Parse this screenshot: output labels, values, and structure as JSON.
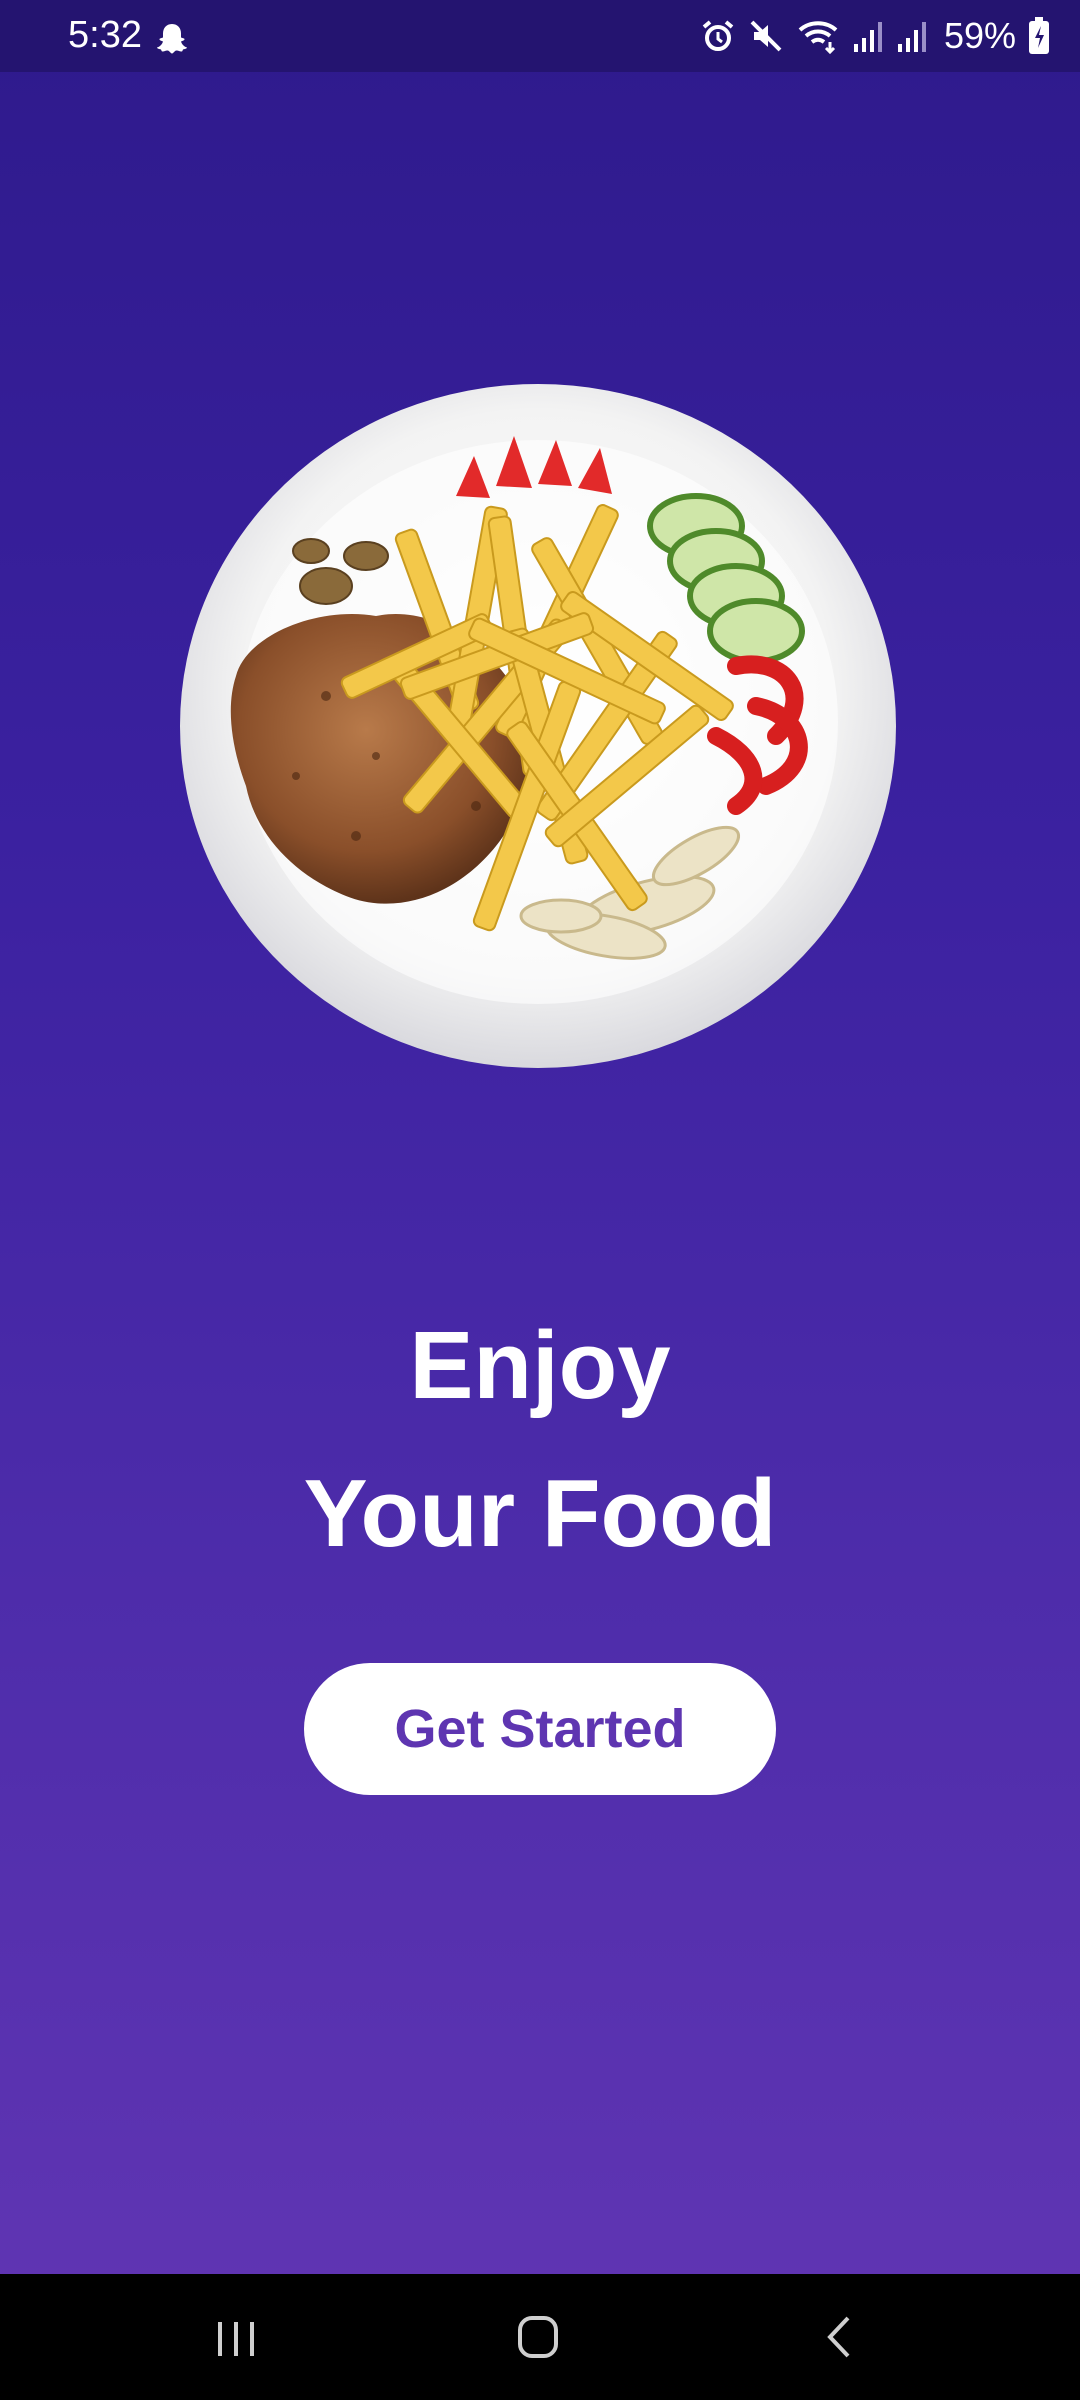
{
  "status_bar": {
    "time": "5:32",
    "battery": "59%",
    "icons": [
      "snapchat-icon",
      "alarm-icon",
      "mute-icon",
      "wifi-icon",
      "signal-icon",
      "signal-icon",
      "battery-charging-icon"
    ]
  },
  "hero": {
    "image": "food-plate-image",
    "title_line1": "Enjoy",
    "title_line2": "Your Food"
  },
  "cta": {
    "label": "Get Started"
  },
  "nav_bar": {
    "buttons": [
      "recents-icon",
      "home-icon",
      "back-icon"
    ]
  },
  "colors": {
    "background_top": "#2e1a8c",
    "background_bottom": "#6236b4",
    "button_text": "#5e35b1",
    "button_bg": "#ffffff"
  }
}
